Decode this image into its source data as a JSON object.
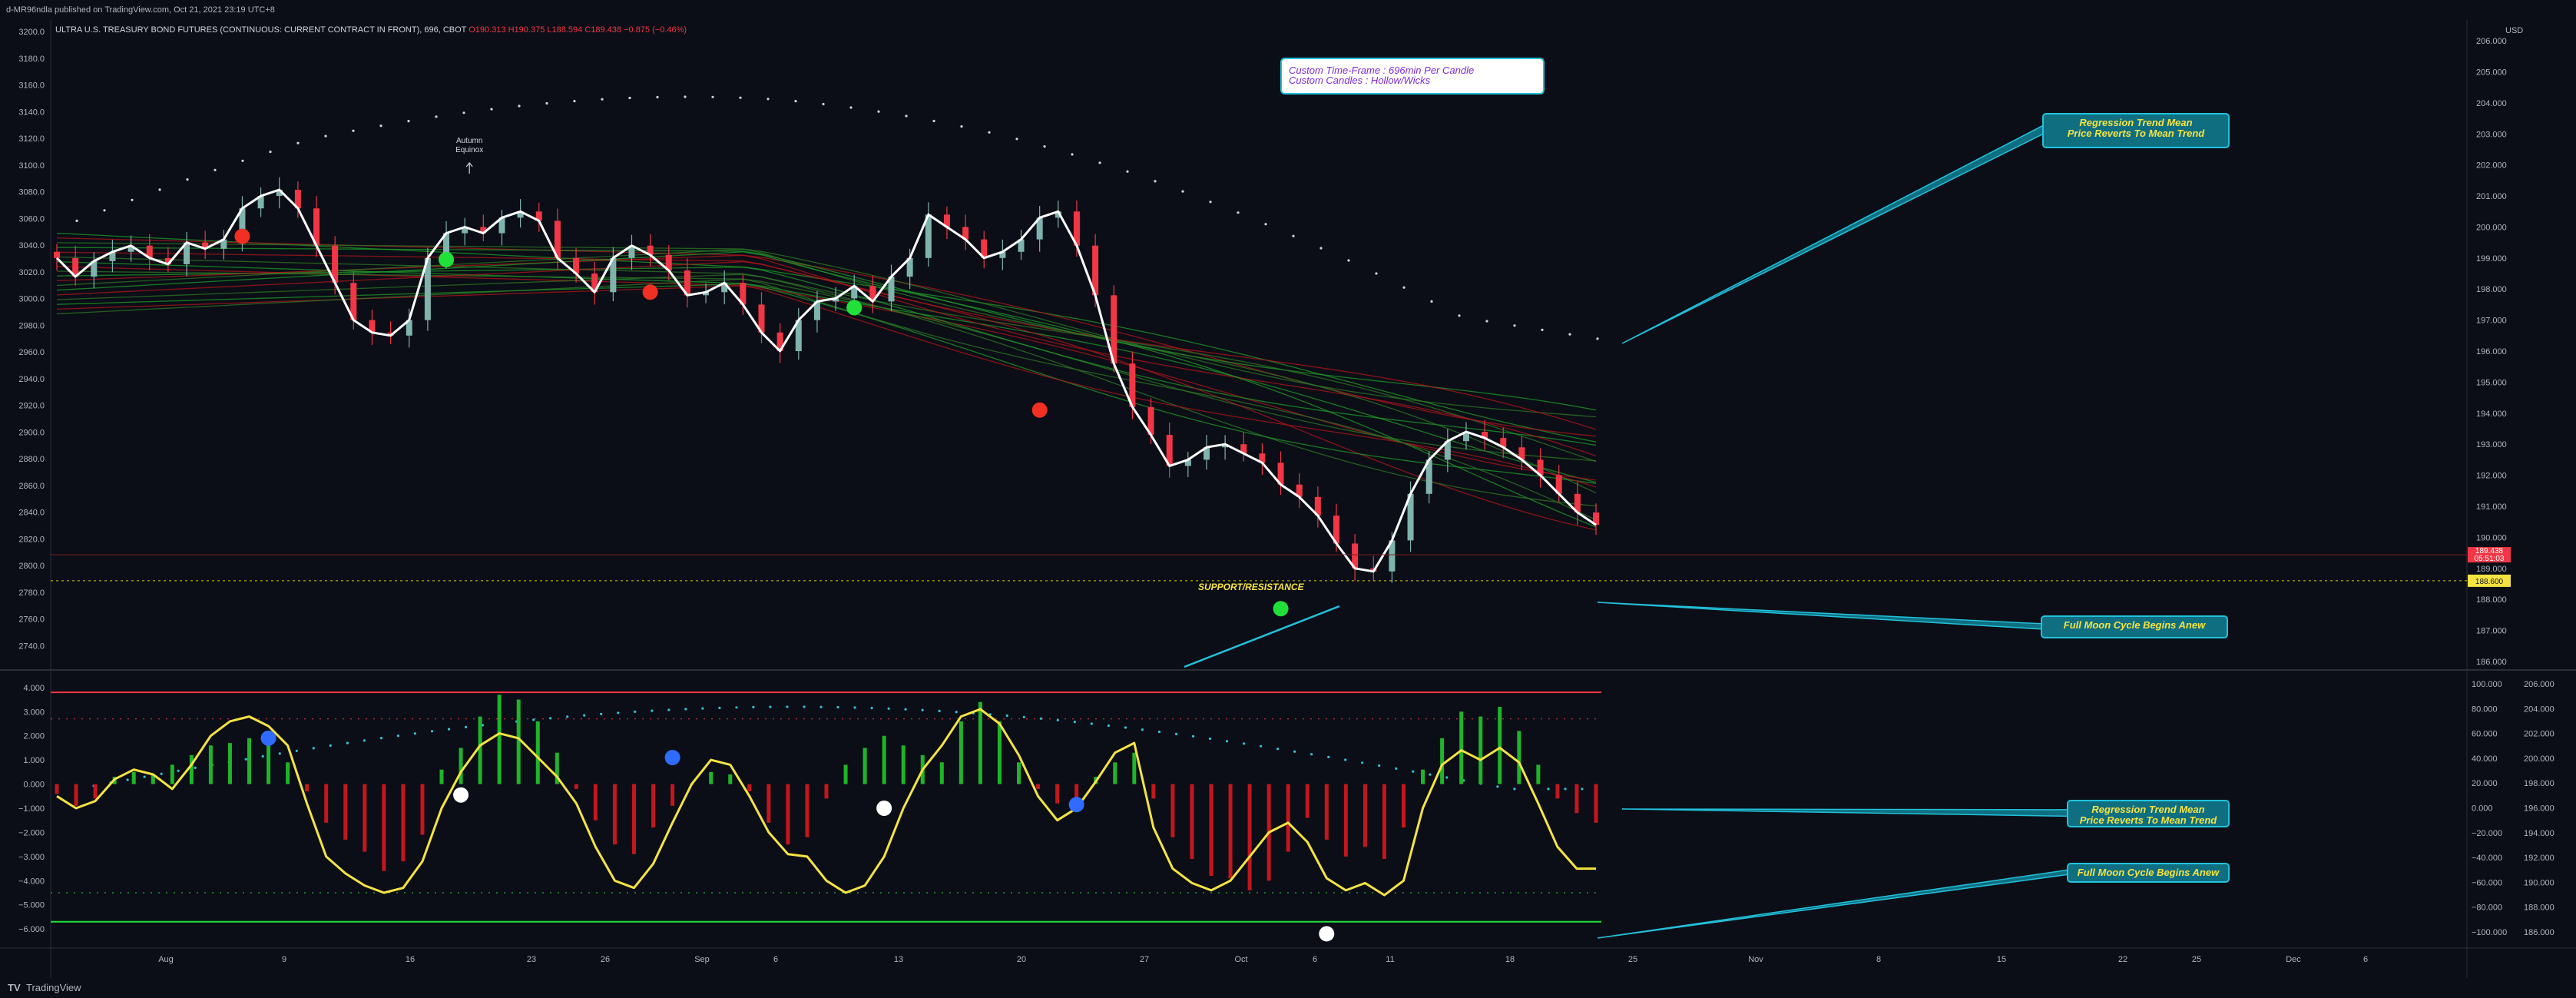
{
  "header": {
    "published": "d-MR96ndla published on TradingView.com, Oct 21, 2021 23:19 UTC+8",
    "symbol": "ULTRA U.S. TREASURY BOND FUTURES (CONTINUOUS: CURRENT CONTRACT IN FRONT), 696, CBOT",
    "open": "O190.313",
    "high": "H190.375",
    "low": "L188.594",
    "close": "C189.438",
    "change": "−0.875 (−0.46%)"
  },
  "footer": {
    "logo": "TV",
    "brand": "TradingView"
  },
  "colors": {
    "background": "#0b0e16",
    "bull": "#7fb3ad",
    "bear": "#f23645",
    "price_line": "#ffffff",
    "oscillator": "#f5e342",
    "callout_border": "#22c1dc",
    "callout_fill": "#0f6f80",
    "callout_text": "#f5e342",
    "green_dot": "#22e03a",
    "red_dot": "#f22f24"
  },
  "chart_data": [
    {
      "type": "candlestick",
      "panel": "price",
      "x_ticks": [
        "Aug",
        "9",
        "16",
        "23",
        "26",
        "Sep",
        "6",
        "13",
        "20",
        "27",
        "Oct",
        "6",
        "11",
        "18",
        "25",
        "Nov",
        "8",
        "15",
        "22",
        "25",
        "Dec",
        "6"
      ],
      "left_ticks": [
        "3200.0",
        "3180.0",
        "3160.0",
        "3140.0",
        "3120.0",
        "3100.0",
        "3080.0",
        "3060.0",
        "3040.0",
        "3020.0",
        "3000.0",
        "2980.0",
        "2960.0",
        "2940.0",
        "2920.0",
        "2900.0",
        "2880.0",
        "2860.0",
        "2840.0",
        "2820.0",
        "2800.0",
        "2780.0",
        "2760.0",
        "2740.0"
      ],
      "right_ticks": [
        "206.000",
        "205.000",
        "204.000",
        "203.000",
        "202.000",
        "201.000",
        "200.000",
        "199.000",
        "198.000",
        "197.000",
        "196.000",
        "195.000",
        "194.000",
        "193.000",
        "192.000",
        "191.000",
        "190.000",
        "189.000",
        "188.000",
        "187.000",
        "186.000"
      ],
      "right_unit": "USD",
      "ylim": [
        185.8,
        206.3
      ],
      "last_price_label": "189.438",
      "countdown_label": "05:51:03",
      "support_price": 188.6,
      "support_label": "188.600",
      "support_text": "SUPPORT/RESISTANCE",
      "annotation": {
        "text": "Autumn\nEquinox",
        "date_index": 22
      },
      "info_box": [
        "Custom Time-Frame : 696min Per Candle",
        "Custom Candles : Hollow/Wicks"
      ],
      "callouts": [
        {
          "lines": [
            "Regression Trend Mean",
            "Price Reverts To Mean Trend"
          ]
        },
        {
          "lines": [
            "Full Moon Cycle Begins Anew"
          ]
        }
      ],
      "closes": [
        199.0,
        198.4,
        198.9,
        199.2,
        199.4,
        199.0,
        198.8,
        199.5,
        199.3,
        199.6,
        200.6,
        201.0,
        201.2,
        200.6,
        199.4,
        198.2,
        197.0,
        196.6,
        196.5,
        197.0,
        199.0,
        199.8,
        200.0,
        199.8,
        200.3,
        200.5,
        200.2,
        199.0,
        198.5,
        197.9,
        199.0,
        199.4,
        199.1,
        198.6,
        197.8,
        197.9,
        198.2,
        197.5,
        196.6,
        196.0,
        197.0,
        197.6,
        197.7,
        198.1,
        197.6,
        198.4,
        199.0,
        200.4,
        200.0,
        199.6,
        199.0,
        199.2,
        199.6,
        200.3,
        200.5,
        199.4,
        197.8,
        195.6,
        194.2,
        193.3,
        192.3,
        192.5,
        192.9,
        193.0,
        192.7,
        192.4,
        191.7,
        191.3,
        190.7,
        189.8,
        189.0,
        188.9,
        189.9,
        191.4,
        192.5,
        193.1,
        193.4,
        193.2,
        192.9,
        192.5,
        192.0,
        191.4,
        190.8,
        190.4
      ],
      "regression_mean": [
        200.2,
        200.5,
        200.7,
        200.5,
        200.3,
        200.1,
        199.9,
        199.6,
        199.3,
        198.9,
        198.4,
        197.8,
        197.0,
        196.4
      ],
      "full_moon_dates": [
        11,
        33,
        49,
        67
      ],
      "dots": [
        {
          "i": 10,
          "y": 199.7,
          "color": "red"
        },
        {
          "i": 21,
          "y": 198.95,
          "color": "green"
        },
        {
          "i": 32,
          "y": 197.9,
          "color": "red"
        },
        {
          "i": 43,
          "y": 197.4,
          "color": "green"
        },
        {
          "i": 53,
          "y": 194.1,
          "color": "red"
        },
        {
          "i": 66,
          "y": 187.7,
          "color": "green"
        }
      ]
    },
    {
      "type": "histogram",
      "panel": "oscillator",
      "left_ticks": [
        "4.000",
        "3.000",
        "2.000",
        "1.000",
        "0.000",
        "−1.000",
        "−2.000",
        "−3.000",
        "−4.000",
        "−5.000",
        "−6.000"
      ],
      "right_ticks_a": [
        "100.000",
        "80.000",
        "60.000",
        "40.000",
        "20.000",
        "0.000",
        "−20.000",
        "−40.000",
        "−60.000",
        "−80.000",
        "−100.000"
      ],
      "right_ticks_b": [
        "206.000",
        "204.000",
        "202.000",
        "200.000",
        "198.000",
        "196.000",
        "194.000",
        "192.000",
        "190.000",
        "188.000",
        "186.000"
      ],
      "ylim": [
        -6.6,
        4.6
      ],
      "upper_band": 3.8,
      "lower_band": -5.7,
      "oscillator": [
        -0.5,
        -1.0,
        -0.7,
        0.2,
        0.6,
        0.4,
        -0.2,
        0.8,
        2.0,
        2.6,
        2.8,
        2.4,
        1.6,
        -0.8,
        -3.0,
        -3.7,
        -4.2,
        -4.5,
        -4.3,
        -3.2,
        -1.0,
        0.5,
        1.6,
        2.1,
        1.9,
        1.1,
        0.3,
        -0.8,
        -2.6,
        -4.0,
        -4.3,
        -3.3,
        -1.6,
        0.0,
        1.0,
        0.8,
        -0.5,
        -2.0,
        -2.9,
        -3.0,
        -4.0,
        -4.5,
        -4.2,
        -3.0,
        -1.0,
        0.6,
        1.6,
        2.8,
        3.1,
        2.5,
        1.2,
        -0.5,
        -1.5,
        -1.0,
        0.1,
        1.3,
        1.7,
        -1.8,
        -3.5,
        -4.1,
        -4.4,
        -4.0,
        -3.0,
        -2.0,
        -1.6,
        -2.4,
        -3.9,
        -4.4,
        -4.1,
        -4.6,
        -4.0,
        -1.0,
        0.8,
        1.4,
        1.0,
        1.5,
        0.9,
        -0.8,
        -2.6,
        -3.5,
        -3.5
      ],
      "histogram": [
        -0.4,
        -0.9,
        -0.6,
        0.3,
        0.5,
        0.4,
        0.8,
        1.2,
        1.6,
        1.7,
        1.9,
        1.6,
        0.9,
        -0.3,
        -1.6,
        -2.3,
        -2.8,
        -3.6,
        -3.2,
        -2.1,
        0.6,
        1.5,
        2.8,
        3.7,
        3.5,
        2.6,
        1.3,
        -0.2,
        -1.5,
        -2.5,
        -2.9,
        -1.8,
        -0.9,
        0.0,
        0.5,
        0.4,
        -0.3,
        -1.6,
        -2.5,
        -2.2,
        -0.6,
        0.8,
        1.5,
        2.0,
        1.6,
        1.2,
        0.9,
        2.6,
        3.4,
        2.6,
        0.9,
        -0.2,
        -0.8,
        -0.6,
        0.3,
        0.9,
        1.3,
        -0.6,
        -2.2,
        -3.1,
        -3.8,
        -3.9,
        -4.4,
        -4.0,
        -2.8,
        -1.4,
        -2.3,
        -3.0,
        -2.6,
        -3.1,
        -1.8,
        0.6,
        1.9,
        3.0,
        2.8,
        3.2,
        2.2,
        0.8,
        -0.6,
        -1.2,
        -1.6
      ],
      "dots": [
        {
          "i": 11,
          "y": 1.9,
          "color": "blue"
        },
        {
          "i": 21,
          "y": -0.45,
          "color": "white"
        },
        {
          "i": 32,
          "y": 1.1,
          "color": "blue"
        },
        {
          "i": 43,
          "y": -1.0,
          "color": "white"
        },
        {
          "i": 53,
          "y": -0.85,
          "color": "blue"
        },
        {
          "i": 66,
          "y": -6.2,
          "color": "white"
        }
      ]
    }
  ]
}
